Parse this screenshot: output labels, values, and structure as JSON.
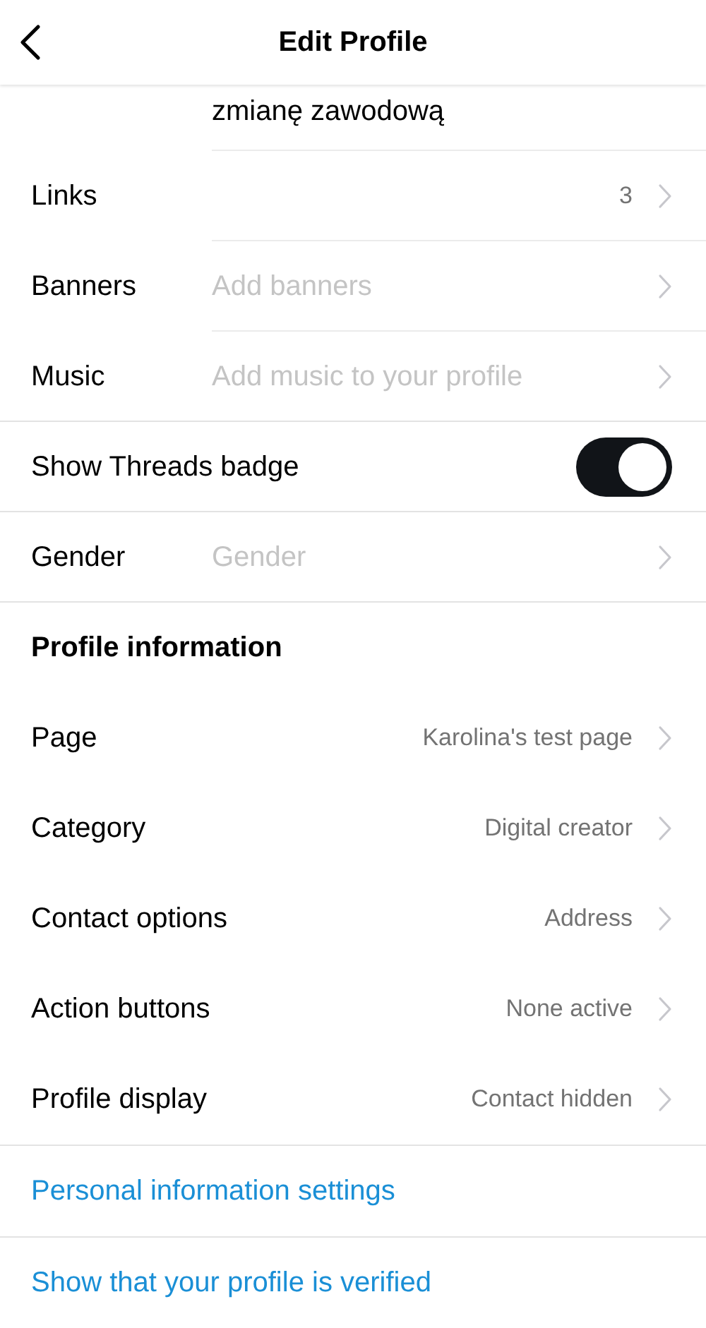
{
  "header": {
    "title": "Edit Profile"
  },
  "bio": {
    "text": "zmianę zawodową"
  },
  "groups": [
    [
      {
        "kind": "value",
        "label": "Links",
        "value": "3"
      },
      {
        "kind": "placeholder",
        "label": "Banners",
        "placeholder": "Add banners"
      },
      {
        "kind": "placeholder",
        "label": "Music",
        "placeholder": "Add music to your profile"
      }
    ],
    [
      {
        "kind": "toggle",
        "label": "Show Threads badge",
        "on": true
      }
    ],
    [
      {
        "kind": "placeholder",
        "label": "Gender",
        "placeholder": "Gender"
      }
    ]
  ],
  "profile_information": {
    "heading": "Profile information",
    "rows": [
      {
        "label": "Page",
        "value": "Karolina's test page"
      },
      {
        "label": "Category",
        "value": "Digital creator"
      },
      {
        "label": "Contact options",
        "value": "Address"
      },
      {
        "label": "Action buttons",
        "value": "None active"
      },
      {
        "label": "Profile display",
        "value": "Contact hidden"
      }
    ]
  },
  "links": [
    "Personal information settings",
    "Show that your profile is verified"
  ]
}
